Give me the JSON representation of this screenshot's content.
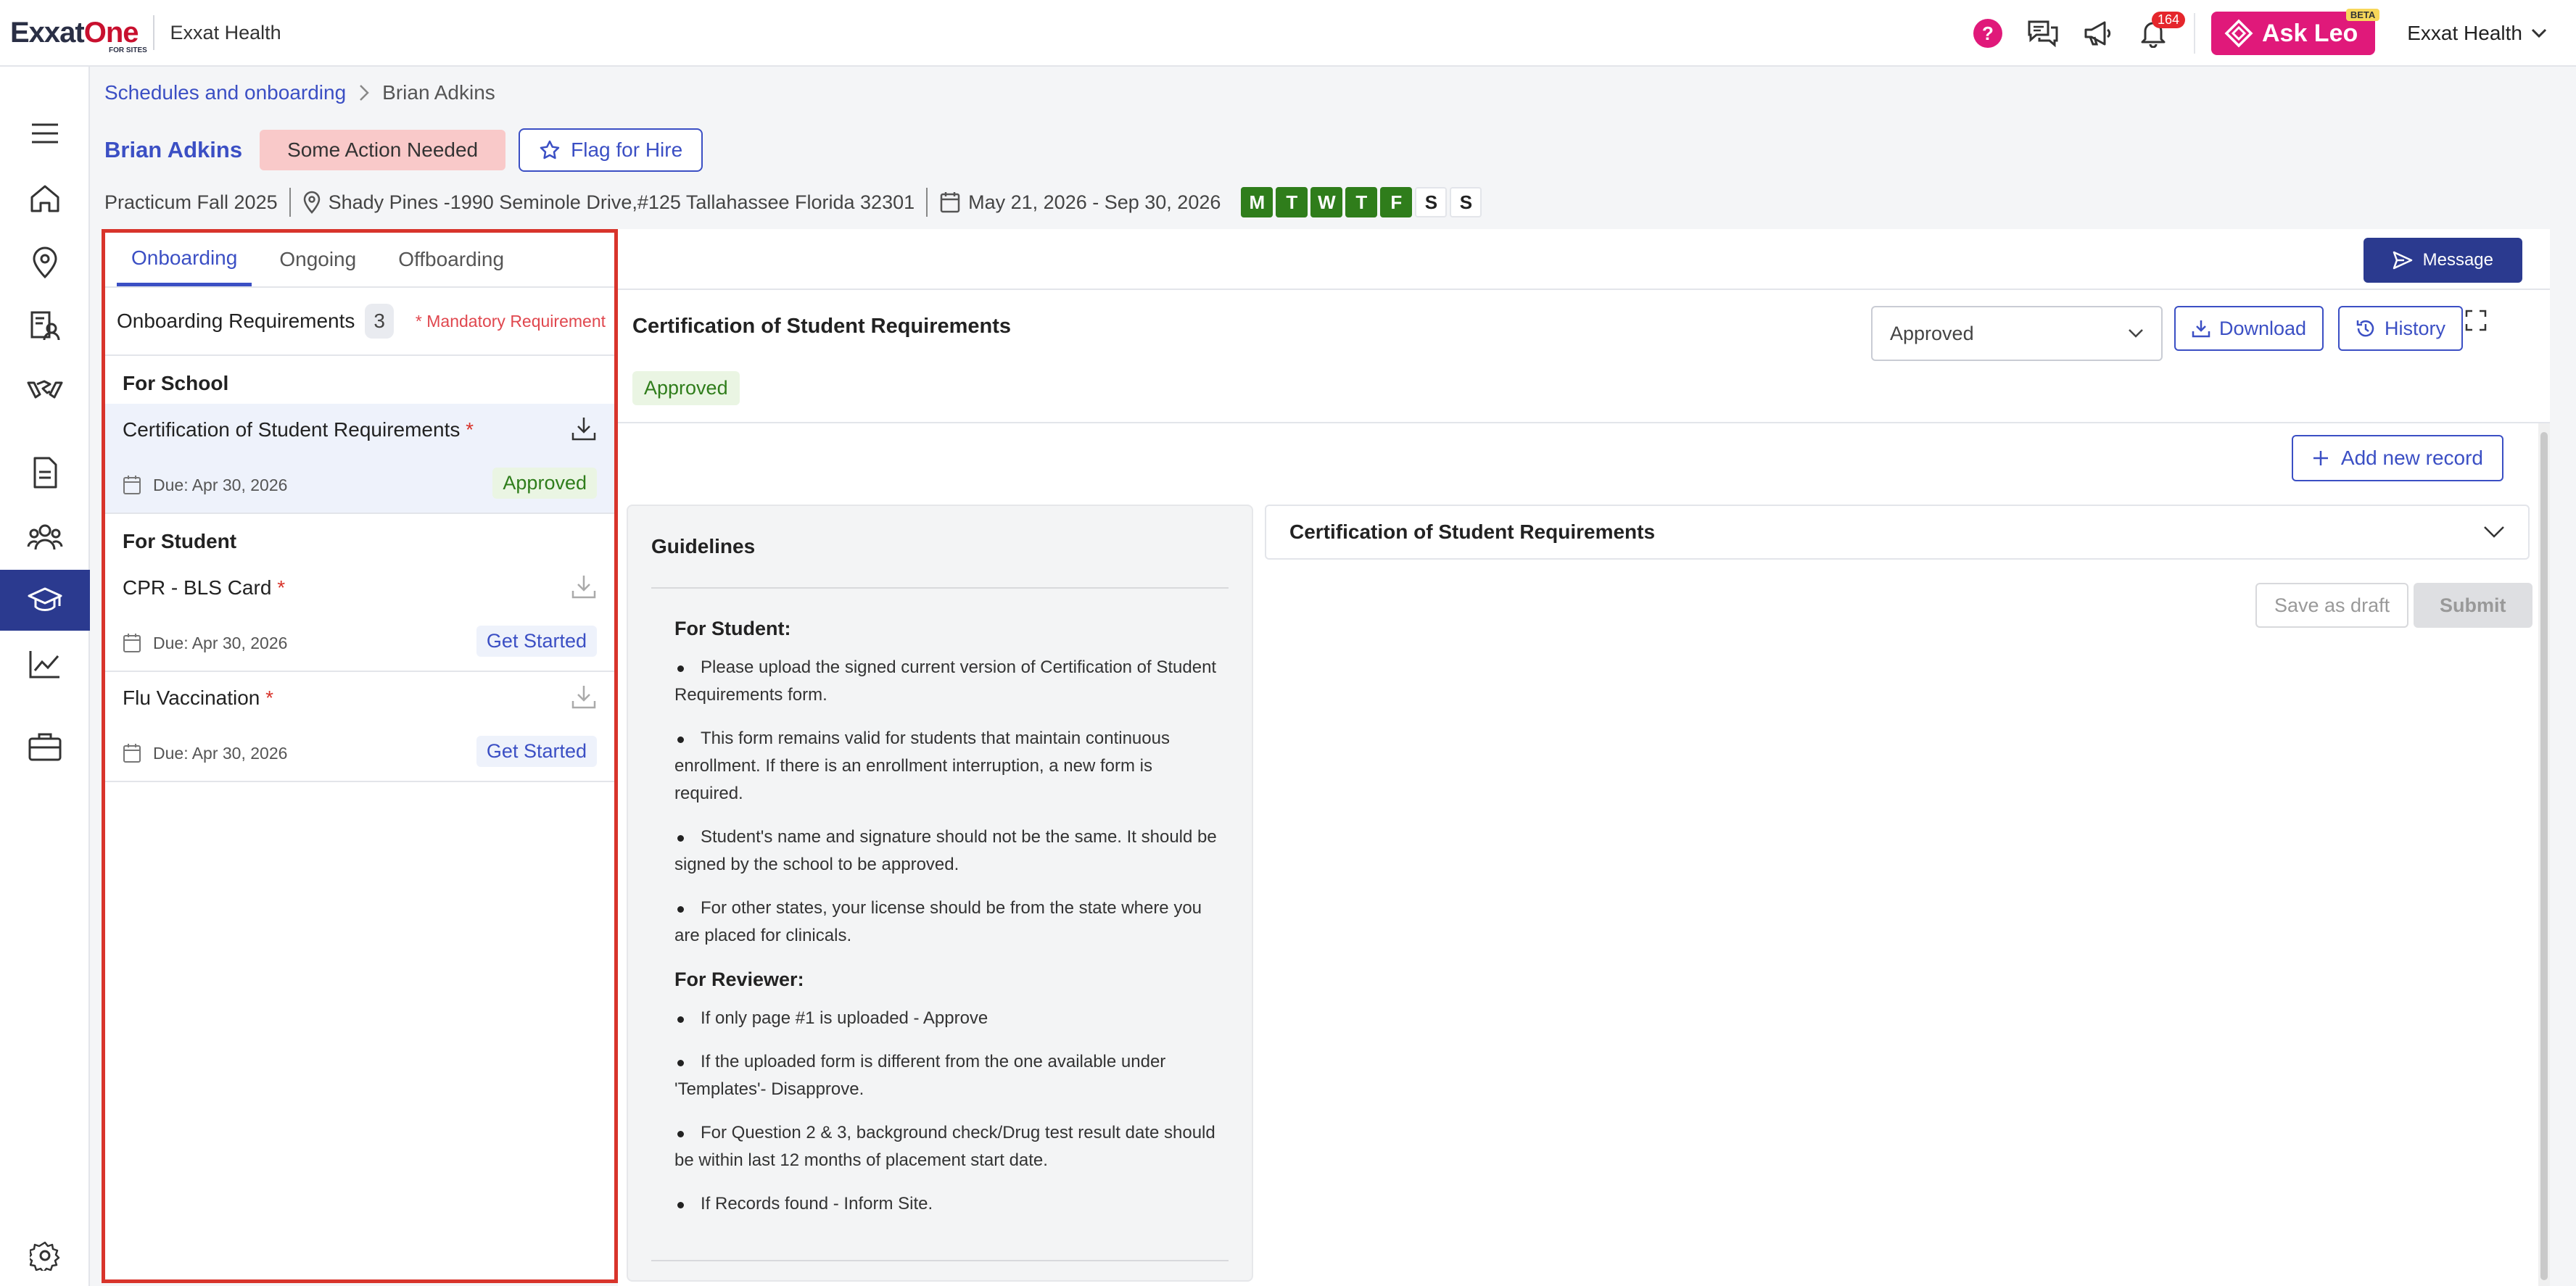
{
  "header": {
    "logo_main": "Exxat",
    "logo_one": "One",
    "logo_sub": "FOR SITES",
    "org_name": "Exxat Health",
    "help_label": "?",
    "notification_count": "164",
    "ask_leo_label": "Ask Leo",
    "beta_label": "BETA",
    "user_label": "Exxat Health"
  },
  "sidebar": {
    "items": [
      {
        "icon": "menu-icon"
      },
      {
        "icon": "home-icon"
      },
      {
        "icon": "location-icon"
      },
      {
        "icon": "profile-card-icon"
      },
      {
        "icon": "handshake-icon"
      },
      {
        "icon": "document-icon"
      },
      {
        "icon": "people-icon"
      },
      {
        "icon": "graduation-cap-icon",
        "active": true
      },
      {
        "icon": "analytics-icon"
      },
      {
        "icon": "briefcase-icon"
      },
      {
        "icon": "settings-icon"
      }
    ]
  },
  "breadcrumb": {
    "parent": "Schedules and onboarding",
    "current": "Brian Adkins"
  },
  "student": {
    "name": "Brian Adkins",
    "status": "Some Action Needed",
    "flag_label": "Flag for Hire"
  },
  "meta": {
    "program": "Practicum Fall 2025",
    "location": "Shady Pines -1990 Seminole Drive,#125 Tallahassee Florida 32301",
    "dates": "May 21, 2026 - Sep 30, 2026",
    "days": [
      {
        "label": "M",
        "on": true
      },
      {
        "label": "T",
        "on": true
      },
      {
        "label": "W",
        "on": true
      },
      {
        "label": "T",
        "on": true
      },
      {
        "label": "F",
        "on": true
      },
      {
        "label": "S",
        "on": false
      },
      {
        "label": "S",
        "on": false
      }
    ]
  },
  "left_panel": {
    "tabs": [
      "Onboarding",
      "Ongoing",
      "Offboarding"
    ],
    "active_tab": "Onboarding",
    "requirements_title": "Onboarding Requirements",
    "requirements_count": "3",
    "mandatory_note": "* Mandatory Requirement",
    "groups": [
      {
        "title": "For School",
        "items": [
          {
            "name": "Certification of Student Requirements",
            "mandatory": "*",
            "due": "Due: Apr 30, 2026",
            "status": "Approved"
          }
        ]
      },
      {
        "title": "For Student",
        "items": [
          {
            "name": "CPR - BLS Card",
            "mandatory": "*",
            "due": "Due: Apr 30, 2026",
            "status": "Get Started"
          },
          {
            "name": "Flu Vaccination",
            "mandatory": "*",
            "due": "Due: Apr 30, 2026",
            "status": "Get Started"
          }
        ]
      }
    ]
  },
  "right_panel": {
    "message_label": "Message",
    "doc_title": "Certification of Student Requirements",
    "doc_status": "Approved",
    "status_select_value": "Approved",
    "download_label": "Download",
    "history_label": "History",
    "add_record_label": "Add new record",
    "guidelines": {
      "title": "Guidelines",
      "student_heading": "For Student:",
      "student_items": [
        "Please upload the signed current version of Certification of Student Requirements form.",
        "This form remains valid for students that maintain continuous enrollment. If there is an enrollment interruption, a new form is required.",
        "Student's name and signature should not be the same. It should be signed by the school to be approved.",
        "For other states, your license should be from the state where you are placed for clinicals."
      ],
      "reviewer_heading": "For Reviewer:",
      "reviewer_items": [
        "If only page #1 is uploaded - Approve",
        "If the uploaded form is different from the one available under 'Templates'- Disapprove.",
        "For Question 2 & 3, background check/Drug test result date should be within last 12 months of placement start date.",
        "If Records found - Inform Site."
      ]
    },
    "accordion_title": "Certification of Student Requirements",
    "save_draft_label": "Save as draft",
    "submit_label": "Submit"
  },
  "colors": {
    "primary": "#3b4fc4",
    "nav_active": "#2b3a8f",
    "accent_pink": "#e0197a",
    "approved_green": "#2f7d1b",
    "highlight_border": "#d8342b"
  }
}
